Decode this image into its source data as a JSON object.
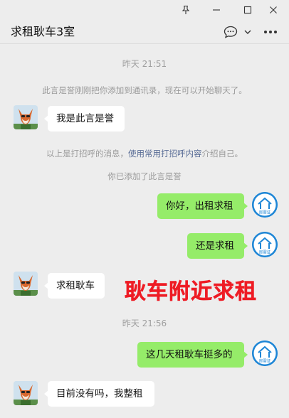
{
  "window": {
    "controls": [
      "pin-icon",
      "minimize-icon",
      "maximize-icon",
      "close-icon"
    ]
  },
  "header": {
    "title": "求租耿车3室",
    "icons": [
      "chat-bubble-icon",
      "chevron-down-icon",
      "more-icon"
    ]
  },
  "messages": [
    {
      "kind": "time",
      "text": "昨天 21:51"
    },
    {
      "kind": "system",
      "text": "此言是誉刚刚把你添加到通讯录，现在可以开始聊天了。"
    },
    {
      "kind": "in",
      "text": "我是此言是誉"
    },
    {
      "kind": "system_link",
      "before": "以上是打招呼的消息，",
      "link": "使用常用打招呼内容",
      "after": "介绍自己。"
    },
    {
      "kind": "system",
      "text": "你已添加了此言是誉"
    },
    {
      "kind": "out",
      "text": "你好，出租求租"
    },
    {
      "kind": "out",
      "text": "还是求租"
    },
    {
      "kind": "in",
      "text": "求租耿车"
    },
    {
      "kind": "time",
      "text": "昨天 21:56"
    },
    {
      "kind": "out",
      "text": "这几天租耿车挺多的"
    },
    {
      "kind": "in",
      "text": "目前没有吗，我整租"
    }
  ],
  "overlay_text": "耿车附近求租",
  "self_avatar_text": "房需证",
  "colors": {
    "background": "#ededed",
    "bubble_out": "#95ec69",
    "bubble_in": "#ffffff",
    "link": "#576b95",
    "overlay": "#ee1c25",
    "self_avatar": "#1e86d6"
  }
}
